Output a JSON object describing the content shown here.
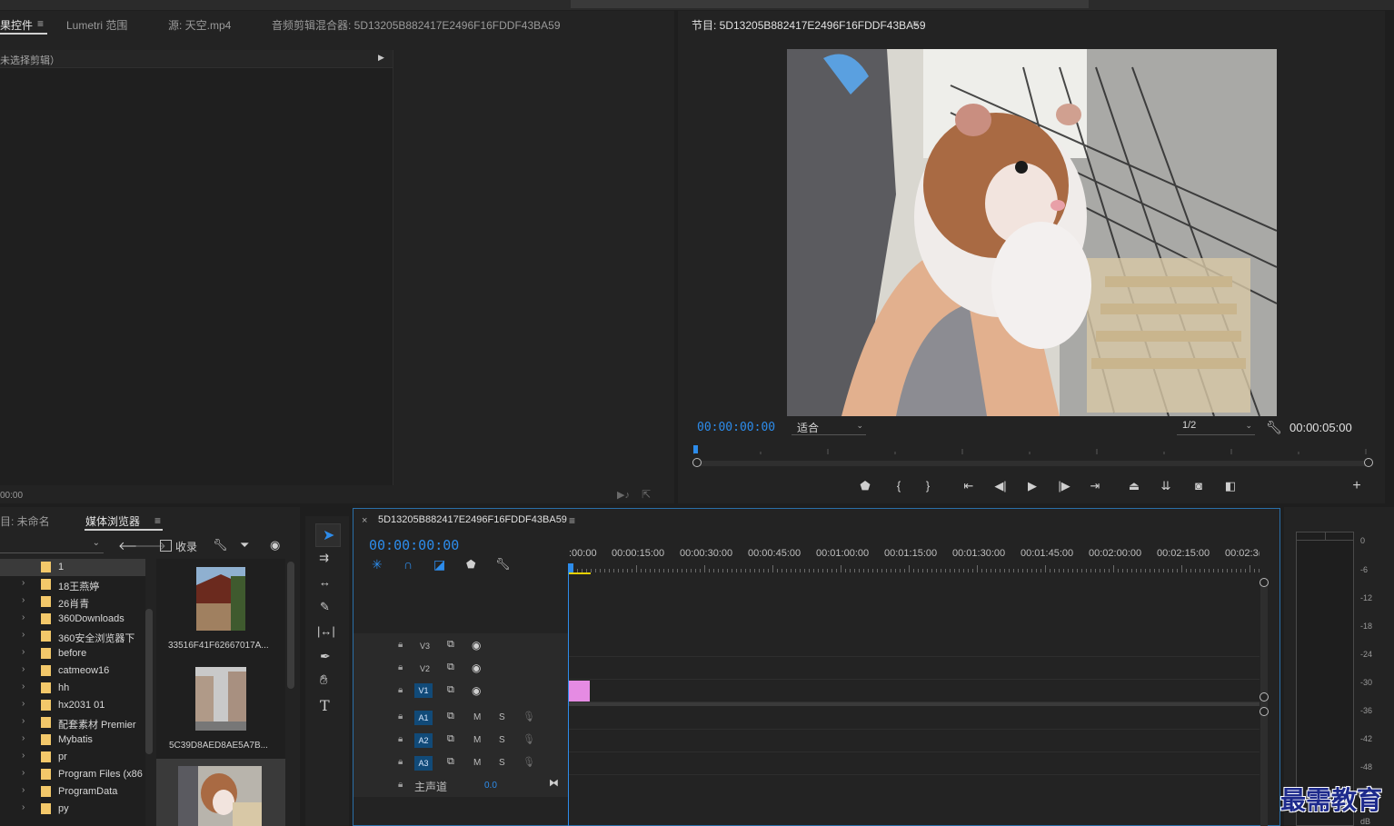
{
  "top_panel": {
    "tabs": [
      {
        "label": "果控件",
        "active": true
      },
      {
        "label": "Lumetri 范围",
        "active": false
      },
      {
        "label": "源: 天空.mp4",
        "active": false
      },
      {
        "label": "音频剪辑混合器: 5D13205B882417E2496F16FDDF43BA59",
        "active": false
      }
    ],
    "no_clip_text": "未选择剪辑）",
    "timecode": "00:00"
  },
  "program_monitor": {
    "title": "节目: 5D13205B882417E2496F16FDDF43BA59",
    "current_timecode": "00:00:00:00",
    "fit_select": "适合",
    "resolution_select": "1/2",
    "duration": "00:00:05:00"
  },
  "project_panel": {
    "tab_project": "目: 未命名",
    "tab_media": "媒体浏览器",
    "favorite_label": "收录",
    "folders": [
      "1",
      "18王燕婷",
      "26肖青",
      "360Downloads",
      "360安全浏览器下",
      "before",
      "catmeow16",
      "hh",
      "hx2031 01",
      "配套素材 Premier",
      "Mybatis",
      "pr",
      "Program Files (x86",
      "ProgramData",
      "py"
    ],
    "thumbnails": [
      "33516F41F62667017A...",
      "5C39D8AED8AE5A7B...",
      ""
    ]
  },
  "timeline": {
    "sequence_name": "5D13205B882417E2496F16FDDF43BA59",
    "timecode": "00:00:00:00",
    "ruler_labels": [
      ":00:00",
      "00:00:15:00",
      "00:00:30:00",
      "00:00:45:00",
      "00:01:00:00",
      "00:01:15:00",
      "00:01:30:00",
      "00:01:45:00",
      "00:02:00:00",
      "00:02:15:00",
      "00:02:3("
    ],
    "video_tracks": [
      "V3",
      "V2",
      "V1"
    ],
    "audio_tracks": [
      "A1",
      "A2",
      "A3"
    ],
    "mute_label": "M",
    "solo_label": "S",
    "master_label": "主声道",
    "master_value": "0.0",
    "clip_color": "#e58be3"
  },
  "audio_meter": {
    "db_labels": [
      "0",
      "-6",
      "-12",
      "-18",
      "-24",
      "-30",
      "-36",
      "-42",
      "-48",
      "dB"
    ]
  },
  "watermark": "最需教育",
  "colors": {
    "accent_blue": "#2d8ceb",
    "panel": "#232323",
    "clip_pink": "#e58be3"
  }
}
